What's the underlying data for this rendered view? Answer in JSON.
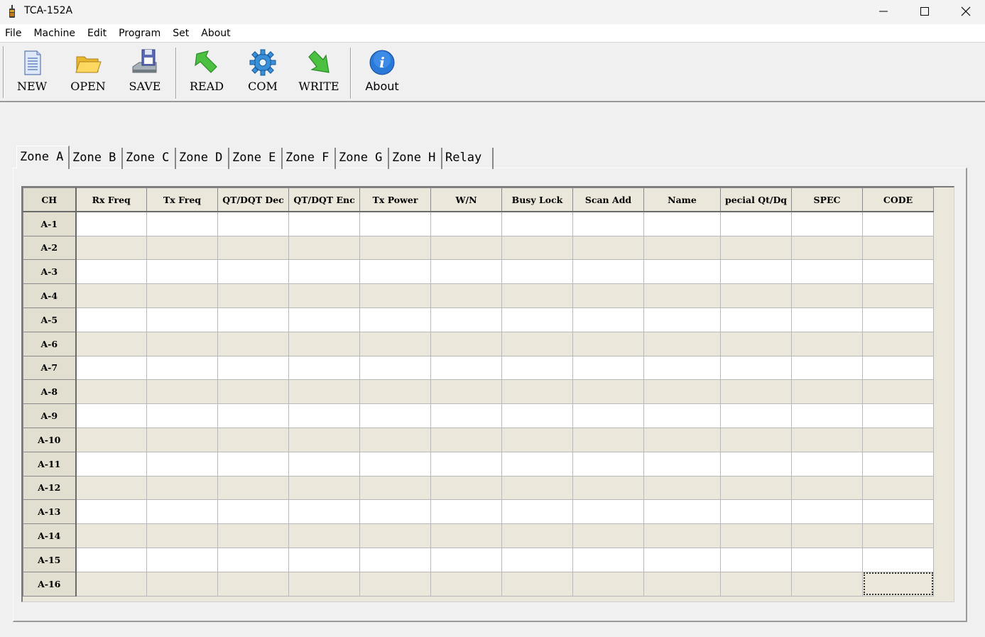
{
  "window": {
    "title": "TCA-152A",
    "icons": {
      "app": "radio-app-icon",
      "minimize": "minimize-icon",
      "maximize": "maximize-icon",
      "close": "close-icon"
    }
  },
  "menu": [
    {
      "label": "File"
    },
    {
      "label": "Machine"
    },
    {
      "label": "Edit"
    },
    {
      "label": "Program"
    },
    {
      "label": "Set"
    },
    {
      "label": "About"
    }
  ],
  "toolbar": {
    "new_label": "NEW",
    "open_label": "OPEN",
    "save_label": "SAVE",
    "read_label": "READ",
    "com_label": "COM",
    "write_label": "WRITE",
    "about_label": "About"
  },
  "tabs": [
    "Zone A",
    "Zone B",
    "Zone C",
    "Zone D",
    "Zone E",
    "Zone F",
    "Zone G",
    "Zone H",
    "Relay"
  ],
  "active_tab": "Zone A",
  "table": {
    "columns": [
      "CH",
      "Rx Freq",
      "Tx Freq",
      "QT/DQT Dec",
      "QT/DQT Enc",
      "Tx Power",
      "W/N",
      "Busy Lock",
      "Scan Add",
      "Name",
      "pecial Qt/Dq",
      "SPEC",
      "CODE"
    ],
    "rows": [
      "A-1",
      "A-2",
      "A-3",
      "A-4",
      "A-5",
      "A-6",
      "A-7",
      "A-8",
      "A-9",
      "A-10",
      "A-11",
      "A-12",
      "A-13",
      "A-14",
      "A-15",
      "A-16"
    ]
  },
  "colors": {
    "row_alt": "#ebe7db",
    "row": "#ffffff",
    "header": "#ebe7db"
  }
}
